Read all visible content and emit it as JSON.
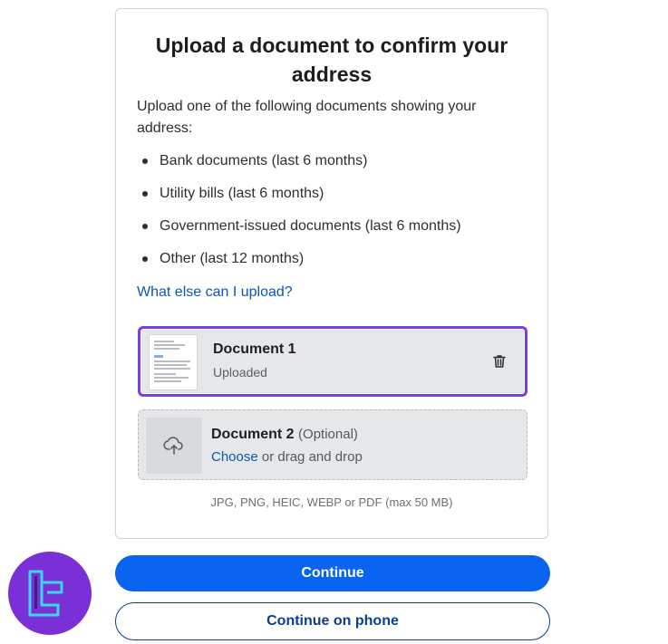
{
  "card": {
    "title": "Upload a document to confirm your address",
    "intro": "Upload one of the following documents showing your address:",
    "documents_accepted": [
      "Bank documents (last 6 months)",
      "Utility bills (last 6 months)",
      "Government-issued documents (last 6 months)",
      "Other (last 12 months)"
    ],
    "help_link": "What else can I upload?",
    "document1": {
      "name": "Document 1",
      "status": "Uploaded",
      "icon": "trash-icon"
    },
    "document2": {
      "name": "Document 2",
      "optional": "(Optional)",
      "choose": "Choose",
      "hint_rest": " or drag and drop",
      "icon": "cloud-upload-icon"
    },
    "formats": "JPG, PNG, HEIC, WEBP or PDF (max 50 MB)"
  },
  "actions": {
    "continue": "Continue",
    "continue_on_phone": "Continue on phone"
  },
  "colors": {
    "primary": "#0a64f0",
    "selected_border": "#7a3fe0",
    "link": "#0a56b8"
  }
}
